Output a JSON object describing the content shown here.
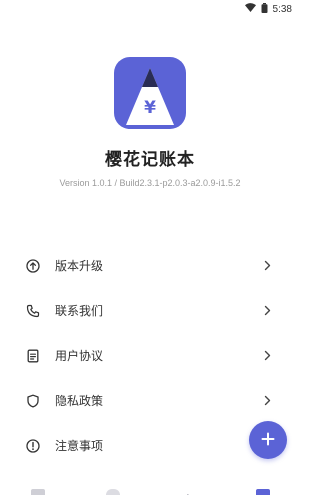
{
  "status_bar": {
    "time": "5:38",
    "icons": [
      "wifi-icon",
      "battery-icon"
    ]
  },
  "app": {
    "name": "樱花记账本",
    "version": "Version 1.0.1 / Build2.3.1-p2.0.3-a2.0.9-i1.5.2",
    "logo_symbol": "¥",
    "accent_color": "#5b63d6"
  },
  "menu": [
    {
      "label": "版本升级",
      "icon": "arrow-up-circle-icon"
    },
    {
      "label": "联系我们",
      "icon": "phone-icon"
    },
    {
      "label": "用户协议",
      "icon": "document-icon"
    },
    {
      "label": "隐私政策",
      "icon": "shield-icon"
    },
    {
      "label": "注意事项",
      "icon": "alert-circle-icon"
    }
  ],
  "fab": {
    "icon": "plus-icon"
  },
  "bottom_nav": {
    "tabs": [
      "tab-home-icon",
      "tab-chart-icon",
      "tab-stats-icon",
      "tab-profile-icon"
    ],
    "active_index": 3
  }
}
